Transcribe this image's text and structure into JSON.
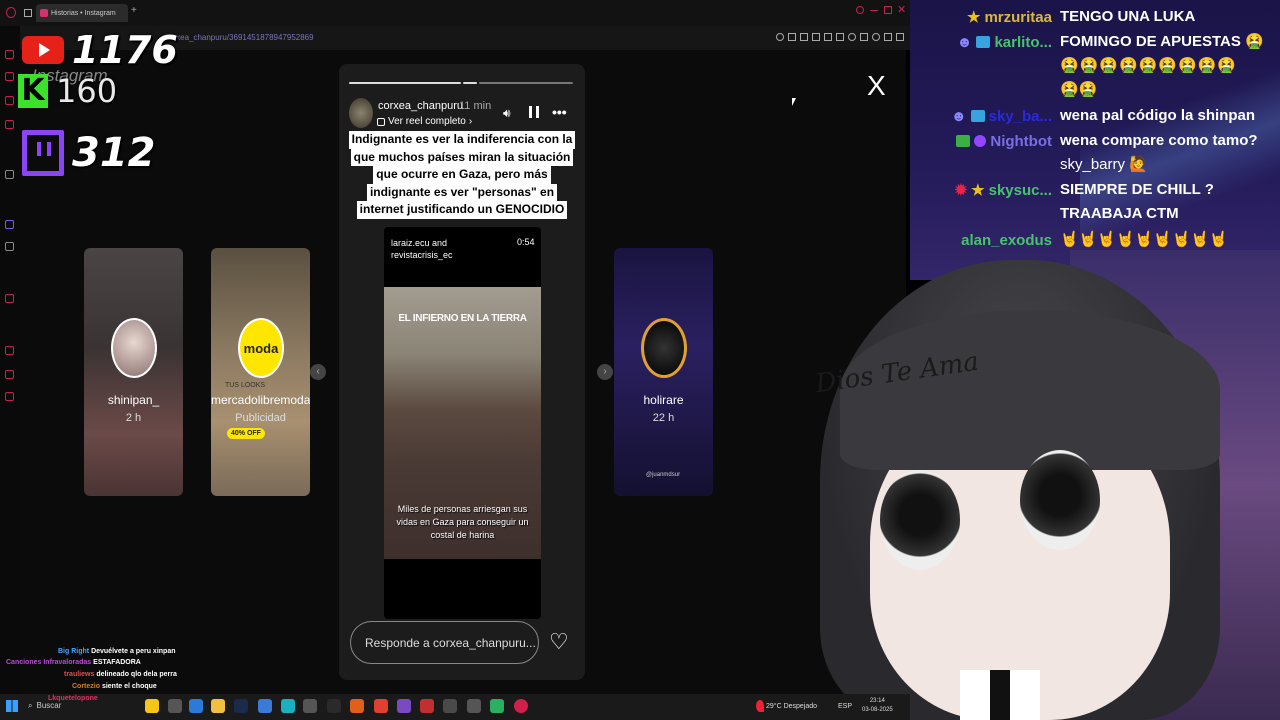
{
  "browser": {
    "tab_title": "Historias • Instagram",
    "url": "corxea_chanpuru/3691451878947952869"
  },
  "stream_counters": {
    "youtube": "1176",
    "kick": "160",
    "twitch": "312",
    "instagram_watermark": "Instagram"
  },
  "story": {
    "username": "corxea_chanpuru",
    "time_ago": "11 min",
    "reel_link": "Ver reel completo",
    "caption_lines": [
      "Indignante es ver la indiferencia con la",
      "que muchos países miran la situación",
      "que ocurre en Gaza, pero más",
      "indignante es ver \"personas\" en",
      "internet justificando un GENOCIDIO"
    ],
    "media_source": "laraiz.ecu and",
    "media_source2": "revistacrisis_ec",
    "duration": "0:54",
    "media_title": "EL INFIERNO EN LA TIERRA",
    "media_subtitle_lines": [
      "Miles de personas arriesgan sus",
      "vidas en Gaza para conseguir un",
      "costal de harina"
    ],
    "reply_placeholder": "Responde a corxea_chanpuru...",
    "close_glyph": "X"
  },
  "cards": [
    {
      "name": "shinipan_",
      "time": "2 h"
    },
    {
      "name": "mercadolibremoda.cl",
      "time": "Publicidad",
      "logo_text": "moda",
      "promo": "40% OFF",
      "looks": "TUS LOOKS"
    },
    {
      "name": "holirare",
      "time": "22 h",
      "footer": "@juanmdsur"
    }
  ],
  "chat": [
    {
      "user": "mrzuritaa",
      "user_color": "#d9b840",
      "msg": "TENGO UNA LUKA"
    },
    {
      "user": "karlito...",
      "user_color": "#48c26d",
      "msg": "FOMINGO DE APUESTAS 🤮"
    },
    {
      "user": "",
      "user_color": "#fff",
      "msg": "🤮🤮🤮🤮🤮🤮🤮🤮🤮"
    },
    {
      "user": "",
      "user_color": "#fff",
      "msg": "🤮🤮"
    },
    {
      "user": "sky_ba...",
      "user_color": "#2a2adc",
      "msg": "wena pal código la shinpan"
    },
    {
      "user": "Nightbot",
      "user_color": "#7a6ee6",
      "msg": "wena compare como tamo?"
    },
    {
      "user": "",
      "user_color": "#fff",
      "msg": "sky_barry 🙋"
    },
    {
      "user": "skysuc...",
      "user_color": "#48c26d",
      "msg": "SIEMPRE DE CHILL ?"
    },
    {
      "user": "",
      "user_color": "#fff",
      "msg": "TRAABAJA CTM"
    },
    {
      "user": "alan_exodus",
      "user_color": "#48c26d",
      "msg": "🤘🤘🤘🤘🤘🤘🤘🤘🤘"
    }
  ],
  "avatar_text": "Dios Te Ama",
  "mini_chat": [
    {
      "user": "Big Right",
      "color": "#4aa3ff",
      "msg": "Devuélvete a peru xinpan"
    },
    {
      "user": "Canciones Infravaloradas",
      "color": "#b84cd6",
      "msg": "ESTAFADORA"
    },
    {
      "user": "trauliews",
      "color": "#e05050",
      "msg": "delineado qlo dela perra"
    },
    {
      "user": "Cortezio",
      "color": "#d08020",
      "msg": "siente el choque"
    },
    {
      "user": "Lkquetelopone",
      "color": "#e03060",
      "msg": ""
    }
  ],
  "taskbar": {
    "search": "Buscar",
    "weather": "29°C  Despejado",
    "lang": "ESP",
    "time": "23:14",
    "date": "03-08-2025"
  }
}
